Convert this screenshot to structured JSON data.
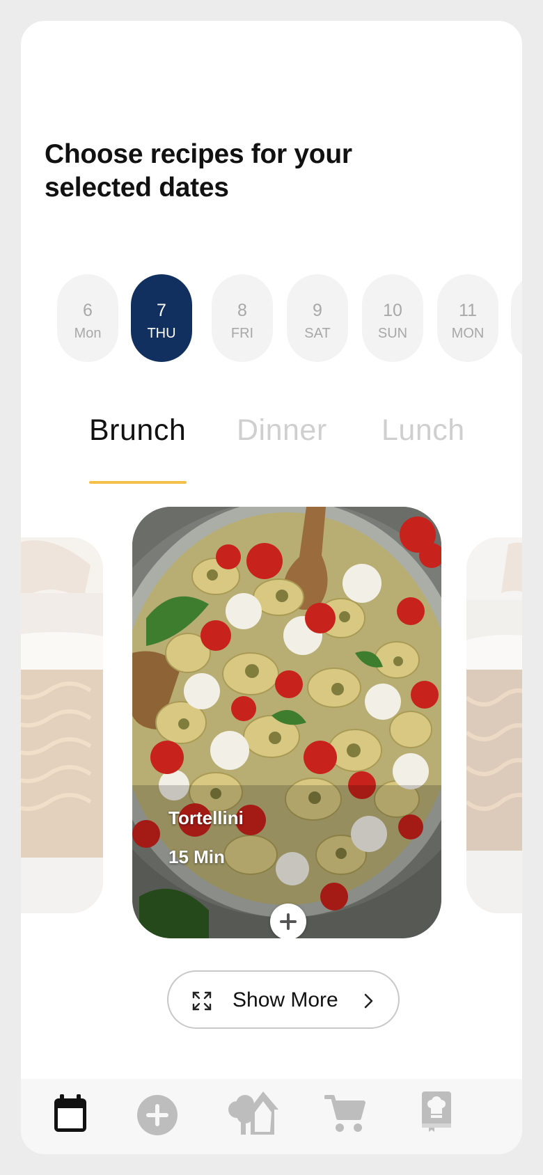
{
  "header": {
    "title_line1": "Choose recipes for your",
    "title_line2": "selected dates"
  },
  "dates": [
    {
      "num": "6",
      "day": "Mon",
      "active": false
    },
    {
      "num": "7",
      "day": "THU",
      "active": true
    },
    {
      "num": "8",
      "day": "FRI",
      "active": false
    },
    {
      "num": "9",
      "day": "SAT",
      "active": false
    },
    {
      "num": "10",
      "day": "SUN",
      "active": false
    },
    {
      "num": "11",
      "day": "MON",
      "active": false
    }
  ],
  "meal_tabs": [
    {
      "label": "Brunch",
      "active": true
    },
    {
      "label": "Dinner",
      "active": false
    },
    {
      "label": "Lunch",
      "active": false
    }
  ],
  "recipe": {
    "name": "Tortellini",
    "time": "15 Min"
  },
  "show_more": {
    "label": "Show More",
    "icon": "expand-icon",
    "trailing_icon": "chevron-right-icon"
  },
  "bottom_nav": [
    {
      "icon": "calendar-icon",
      "active": true
    },
    {
      "icon": "add-circle-icon",
      "active": false
    },
    {
      "icon": "tree-house-icon",
      "active": false
    },
    {
      "icon": "cart-icon",
      "active": false
    },
    {
      "icon": "cookbook-icon",
      "active": false
    }
  ],
  "colors": {
    "accent": "#12305f",
    "tab_underline": "#f4c04a",
    "inactive_text": "#cfcfcf",
    "chip_background": "#f3f3f3"
  }
}
